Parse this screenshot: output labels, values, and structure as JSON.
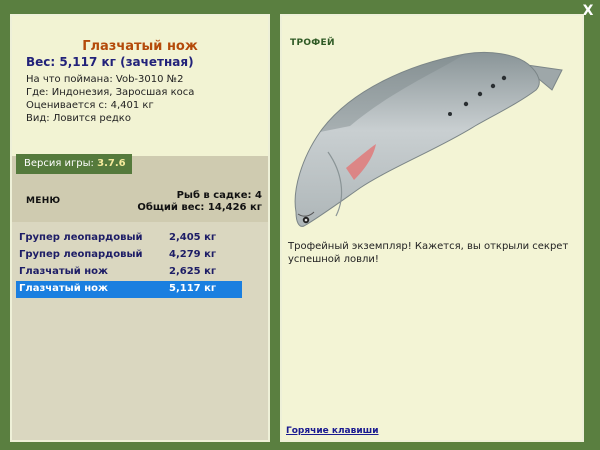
{
  "fish": {
    "title": "Глазчатый нож",
    "weight": "Вес: 5,117 кг (зачетная)",
    "bait": "На что поймана: Vob-3010 №2",
    "location": "Где: Индонезия, Заросшая коса",
    "value": "Оценивается с: 4,401 кг",
    "kind": "Вид: Ловится редко"
  },
  "version": {
    "label": "Версия игры:",
    "number": "3.7.6"
  },
  "menu": {
    "label": "МЕНЮ"
  },
  "cage": {
    "count": "Рыб в садке: 4",
    "total": "Общий вес: 14,426 кг"
  },
  "catch_list": [
    {
      "name": "Групер леопардовый",
      "weight": "2,405 кг"
    },
    {
      "name": "Групер леопардовый",
      "weight": "4,279 кг"
    },
    {
      "name": "Глазчатый нож",
      "weight": "2,625 кг"
    },
    {
      "name": "Глазчатый нож",
      "weight": "5,117 кг"
    }
  ],
  "selected_index": 3,
  "trophy": {
    "label": "ТРОФЕЙ",
    "caption": "Трофейный экземпляр! Кажется, вы открыли секрет успешной ловли!"
  },
  "hotkeys": {
    "label": "Горячие клавиши"
  },
  "close": {
    "glyph": "X"
  },
  "colors": {
    "frame": "#5a7f40",
    "selection": "#1a7fe0",
    "title": "#b44a0a",
    "weight": "#22227a"
  }
}
